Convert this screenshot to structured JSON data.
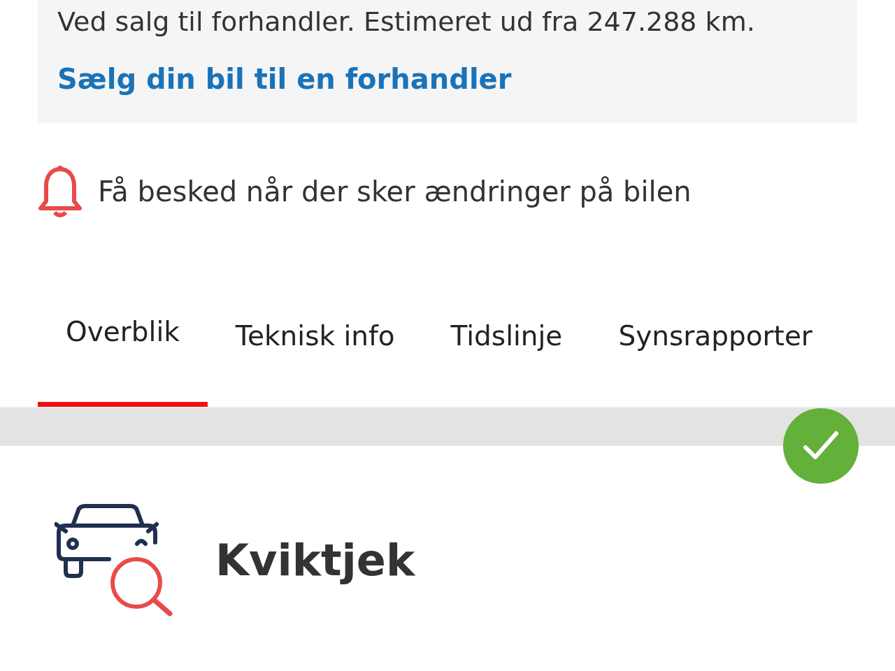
{
  "estimate": {
    "text": "Ved salg til forhandler. Estimeret ud fra 247.288 km.",
    "link": "Sælg din bil til en forhandler"
  },
  "notify": {
    "label": "Få besked når der sker ændringer på bilen"
  },
  "tabs": [
    {
      "label": "Overblik",
      "selected": true
    },
    {
      "label": "Teknisk info",
      "selected": false
    },
    {
      "label": "Tidslinje",
      "selected": false
    },
    {
      "label": "Synsrapporter",
      "selected": false
    }
  ],
  "status": {
    "ok": true
  },
  "section": {
    "title": "Kviktjek"
  }
}
